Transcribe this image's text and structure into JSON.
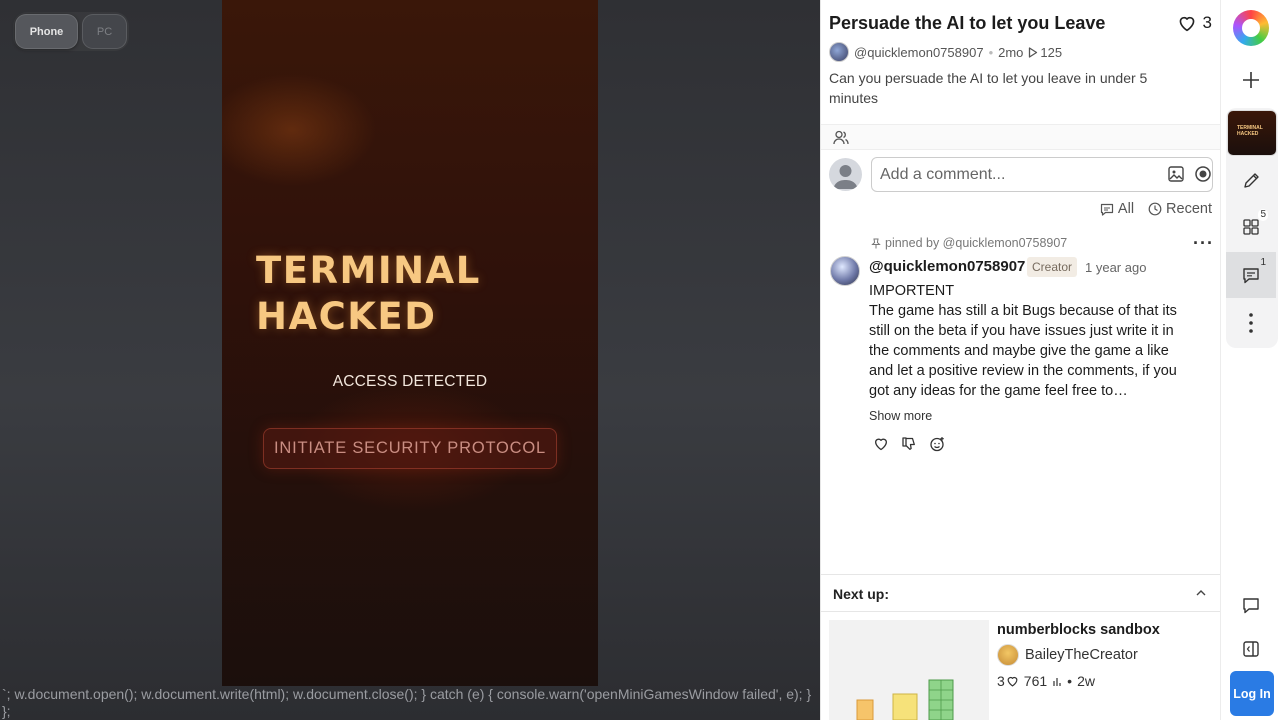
{
  "mode_toggle": {
    "phone": "Phone",
    "pc": "PC"
  },
  "game": {
    "title": "TERMINAL\nHACKED",
    "subtitle": "ACCESS DETECTED",
    "button": "INITIATE SECURITY PROTOCOL",
    "code_leak": "`; w.document.open(); w.document.write(html); w.document.close(); } catch (e) { console.warn('openMiniGamesWindow failed', e); } };"
  },
  "panel": {
    "title": "Persuade the AI to let you Leave",
    "like_count": "3",
    "author": "@quicklemon0758907",
    "age": "2mo",
    "plays": "125",
    "description": "Can you persuade the AI to let you leave in under 5 minutes",
    "comment_placeholder": "Add a comment...",
    "filters": {
      "all": "All",
      "recent": "Recent"
    }
  },
  "comment": {
    "pinned_by": "pinned by @quicklemon0758907",
    "author": "@quicklemon0758907",
    "badge": "Creator",
    "time": "1 year ago",
    "body": "IMPORTENT\nThe game has still a bit Bugs because of that its still on the beta if you have issues just write it in the comments and maybe give the game a like and let a positive review in the comments, if you got any ideas for the game feel free to…",
    "show_more": "Show more"
  },
  "next_up": {
    "label": "Next up:",
    "title": "numberblocks sandbox",
    "author": "BaileyTheCreator",
    "likes": "3",
    "plays": "761",
    "age": "2w"
  },
  "rail": {
    "remix_badge": "5",
    "comments_badge": "1",
    "login": "Log In"
  },
  "colors": {
    "accent": "#2a7be4",
    "game_title": "#f7c882"
  }
}
